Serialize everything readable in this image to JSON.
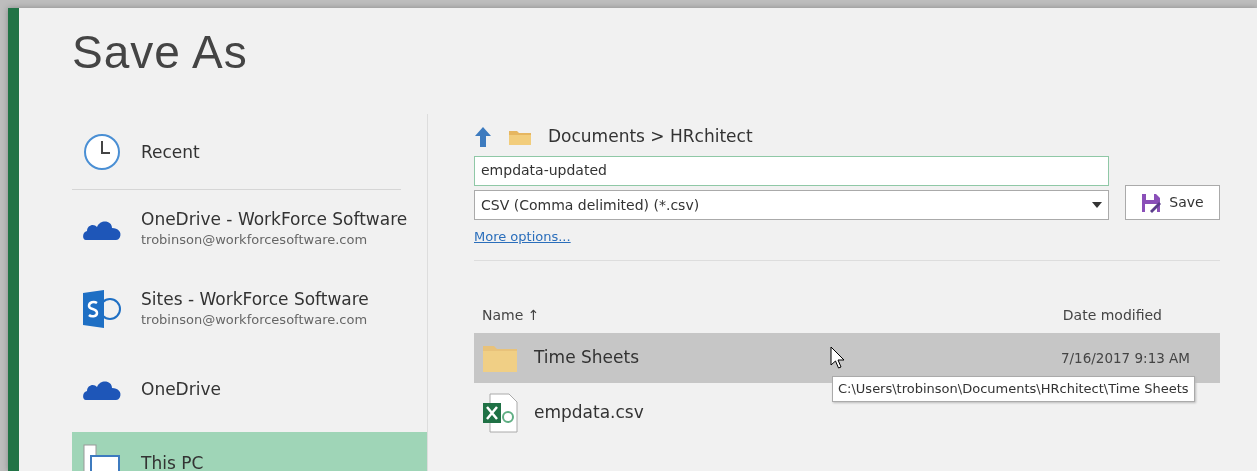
{
  "title": "Save As",
  "places": [
    {
      "kind": "clock",
      "label": "Recent",
      "selected": false
    },
    {
      "kind": "cloud",
      "label": "OneDrive - WorkForce Software",
      "sub": "trobinson@workforcesoftware.com",
      "selected": false
    },
    {
      "kind": "sharepoint",
      "label": "Sites - WorkForce Software",
      "sub": "trobinson@workforcesoftware.com",
      "selected": false
    },
    {
      "kind": "cloud",
      "label": "OneDrive",
      "selected": false
    },
    {
      "kind": "pc",
      "label": "This PC",
      "selected": true
    }
  ],
  "breadcrumb": "Documents > HRchitect",
  "file_name": "empdata-updated",
  "file_type": "CSV (Comma delimited) (*.csv)",
  "save_button": "Save",
  "more_options": "More options...",
  "columns": {
    "name": "Name",
    "sort_arrow": "↑",
    "date": "Date modified"
  },
  "files": [
    {
      "kind": "folder",
      "name": "Time Sheets",
      "date": "7/16/2017 9:13 AM",
      "selected": true
    },
    {
      "kind": "excel",
      "name": "empdata.csv",
      "selected": false
    }
  ],
  "tooltip": "C:\\Users\\trobinson\\Documents\\HRchitect\\Time Sheets"
}
